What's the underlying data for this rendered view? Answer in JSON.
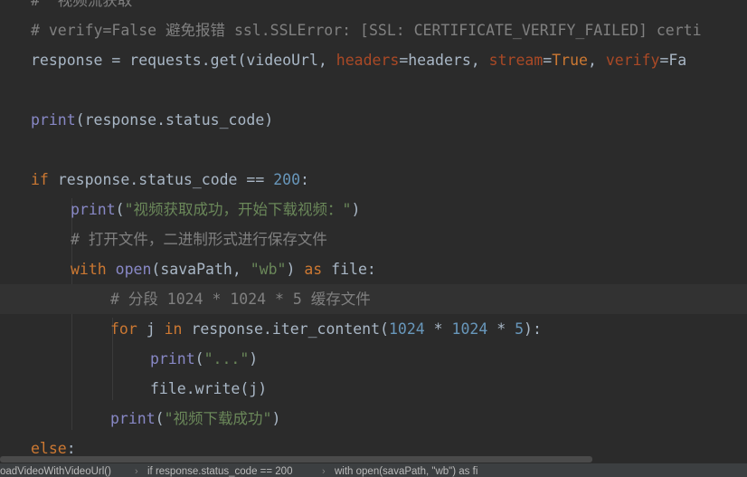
{
  "editor": {
    "lines": [
      {
        "indent": 0,
        "tokens": [
          {
            "t": "#  视频流获取",
            "c": "cmt"
          }
        ]
      },
      {
        "indent": 0,
        "tokens": [
          {
            "t": "# verify=False 避免报错 ssl.SSLError: [SSL: CERTIFICATE_VERIFY_FAILED] certi",
            "c": "cmt"
          }
        ]
      },
      {
        "indent": 0,
        "tokens": [
          {
            "t": "response = requests.get(videoUrl, ",
            "c": ""
          },
          {
            "t": "headers",
            "c": "param"
          },
          {
            "t": "=headers, ",
            "c": ""
          },
          {
            "t": "stream",
            "c": "param"
          },
          {
            "t": "=",
            "c": ""
          },
          {
            "t": "True",
            "c": "kw"
          },
          {
            "t": ", ",
            "c": ""
          },
          {
            "t": "verify",
            "c": "param"
          },
          {
            "t": "=Fa",
            "c": ""
          }
        ]
      },
      {
        "indent": 0,
        "tokens": []
      },
      {
        "indent": 0,
        "tokens": [
          {
            "t": "print",
            "c": "bi"
          },
          {
            "t": "(response.status_code)",
            "c": ""
          }
        ]
      },
      {
        "indent": 0,
        "tokens": []
      },
      {
        "indent": 0,
        "tokens": [
          {
            "t": "if ",
            "c": "kw"
          },
          {
            "t": "response.status_code == ",
            "c": ""
          },
          {
            "t": "200",
            "c": "num"
          },
          {
            "t": ":",
            "c": ""
          }
        ]
      },
      {
        "indent": 1,
        "tokens": [
          {
            "t": "print",
            "c": "bi"
          },
          {
            "t": "(",
            "c": ""
          },
          {
            "t": "\"视频获取成功，开始下载视频：\"",
            "c": "str"
          },
          {
            "t": ")",
            "c": ""
          }
        ]
      },
      {
        "indent": 1,
        "tokens": [
          {
            "t": "# 打开文件，二进制形式进行保存文件",
            "c": "cmt"
          }
        ]
      },
      {
        "indent": 1,
        "tokens": [
          {
            "t": "with ",
            "c": "kw"
          },
          {
            "t": "open",
            "c": "bi"
          },
          {
            "t": "(savaPath, ",
            "c": ""
          },
          {
            "t": "\"wb\"",
            "c": "str"
          },
          {
            "t": ") ",
            "c": ""
          },
          {
            "t": "as ",
            "c": "kw"
          },
          {
            "t": "file:",
            "c": ""
          }
        ]
      },
      {
        "indent": 2,
        "current": true,
        "tokens": [
          {
            "t": "# 分段 1024 * 1024 * 5 缓存文件",
            "c": "cmt"
          }
        ]
      },
      {
        "indent": 2,
        "tokens": [
          {
            "t": "for ",
            "c": "kw"
          },
          {
            "t": "j ",
            "c": ""
          },
          {
            "t": "in ",
            "c": "kw"
          },
          {
            "t": "response.iter_content(",
            "c": ""
          },
          {
            "t": "1024",
            "c": "num"
          },
          {
            "t": " * ",
            "c": ""
          },
          {
            "t": "1024",
            "c": "num"
          },
          {
            "t": " * ",
            "c": ""
          },
          {
            "t": "5",
            "c": "num"
          },
          {
            "t": "):",
            "c": ""
          }
        ]
      },
      {
        "indent": 3,
        "tokens": [
          {
            "t": "print",
            "c": "bi"
          },
          {
            "t": "(",
            "c": ""
          },
          {
            "t": "\"...\"",
            "c": "str"
          },
          {
            "t": ")",
            "c": ""
          }
        ]
      },
      {
        "indent": 3,
        "tokens": [
          {
            "t": "file.write(j)",
            "c": ""
          }
        ]
      },
      {
        "indent": 2,
        "tokens": [
          {
            "t": "print",
            "c": "bi"
          },
          {
            "t": "(",
            "c": ""
          },
          {
            "t": "\"视频下载成功\"",
            "c": "str"
          },
          {
            "t": ")",
            "c": ""
          }
        ]
      },
      {
        "indent": 0,
        "tokens": [
          {
            "t": "else",
            "c": "kw"
          },
          {
            "t": ":",
            "c": ""
          }
        ]
      }
    ]
  },
  "breadcrumb": {
    "items": [
      "oadVideoWithVideoUrl()",
      "if response.status_code == 200",
      "with open(savaPath, \"wb\") as fi"
    ],
    "separator": "›"
  }
}
